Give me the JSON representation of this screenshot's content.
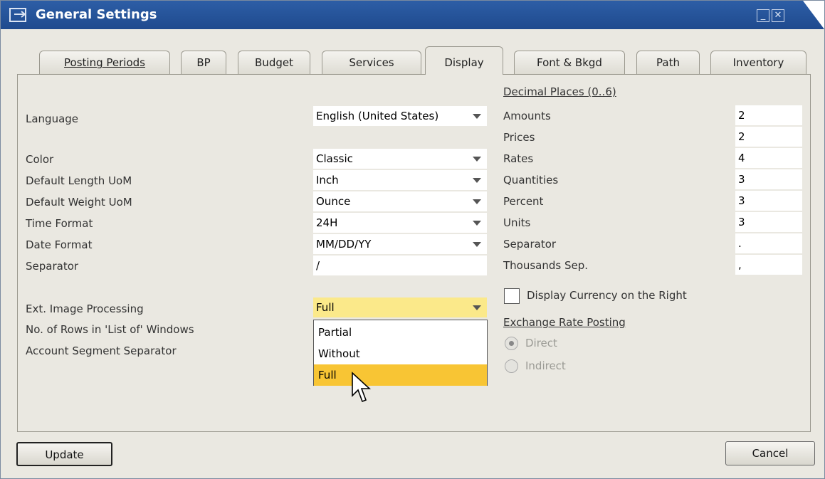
{
  "window": {
    "title": "General Settings"
  },
  "tabs": [
    {
      "label": "Posting Periods"
    },
    {
      "label": "BP"
    },
    {
      "label": "Budget"
    },
    {
      "label": "Services"
    },
    {
      "label": "Display",
      "active": true
    },
    {
      "label": "Font & Bkgd"
    },
    {
      "label": "Path"
    },
    {
      "label": "Inventory"
    }
  ],
  "left": {
    "language_label": "Language",
    "language_value": "English (United States)",
    "color_label": "Color",
    "color_value": "Classic",
    "length_label": "Default Length UoM",
    "length_value": "Inch",
    "weight_label": "Default Weight UoM",
    "weight_value": "Ounce",
    "time_label": "Time Format",
    "time_value": "24H",
    "date_label": "Date Format",
    "date_value": "MM/DD/YY",
    "separator_label": "Separator",
    "separator_value": "/",
    "image_label": "Ext. Image Processing",
    "image_value": "Full",
    "rows_label": "No. of Rows in 'List of' Windows",
    "segment_label": "Account Segment Separator"
  },
  "dropdown": {
    "options": [
      "Partial",
      "Without",
      "Full"
    ],
    "selected": "Full"
  },
  "right": {
    "decimal_heading": "Decimal Places  (0..6)",
    "amounts_label": "Amounts",
    "amounts_value": "2",
    "prices_label": "Prices",
    "prices_value": "2",
    "rates_label": "Rates",
    "rates_value": "4",
    "quantities_label": "Quantities",
    "quantities_value": "3",
    "percent_label": "Percent",
    "percent_value": "3",
    "units_label": "Units",
    "units_value": "3",
    "separator_label": "Separator",
    "separator_value": ".",
    "thousands_label": "Thousands Sep.",
    "thousands_value": ",",
    "currency_right_label": "Display Currency on the Right",
    "exchange_heading": "Exchange Rate Posting",
    "direct_label": "Direct",
    "indirect_label": "Indirect"
  },
  "buttons": {
    "update": "Update",
    "cancel": "Cancel"
  },
  "colors": {
    "titlebar": "#2659a0",
    "highlight_field": "#fbe98a",
    "selected_option": "#f8c534"
  }
}
